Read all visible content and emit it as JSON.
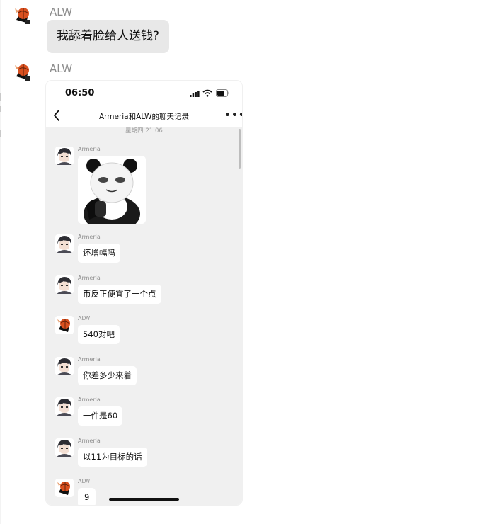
{
  "messages": [
    {
      "sender": "ALW",
      "text": "我舔着脸给人送钱?"
    },
    {
      "sender": "ALW"
    }
  ],
  "screenshot": {
    "status_bar": {
      "time": "06:50"
    },
    "nav": {
      "title": "Armeria和ALW的聊天记录"
    },
    "timestamp": "星期四 21:06",
    "chat": [
      {
        "sender": "Armeria",
        "type": "sticker"
      },
      {
        "sender": "Armeria",
        "text": "还增幅吗"
      },
      {
        "sender": "Armeria",
        "text": "币反正便宜了一个点"
      },
      {
        "sender": "ALW",
        "text": "540对吧"
      },
      {
        "sender": "Armeria",
        "text": "你差多少来着"
      },
      {
        "sender": "Armeria",
        "text": "一件是60"
      },
      {
        "sender": "Armeria",
        "text": "以11为目标的话"
      },
      {
        "sender": "ALW",
        "text": "9"
      }
    ]
  },
  "icons": {
    "alw_avatar": "orange-basketball-anime-avatar-icon",
    "armeria_avatar": "white-hair-anime-avatar-icon",
    "sticker": "panda-meme-sticker"
  },
  "colors": {
    "outer_bubble": "#e8e8e8",
    "phone_chat_bg": "#f0f0f0",
    "chat_bubble": "#ffffff"
  }
}
